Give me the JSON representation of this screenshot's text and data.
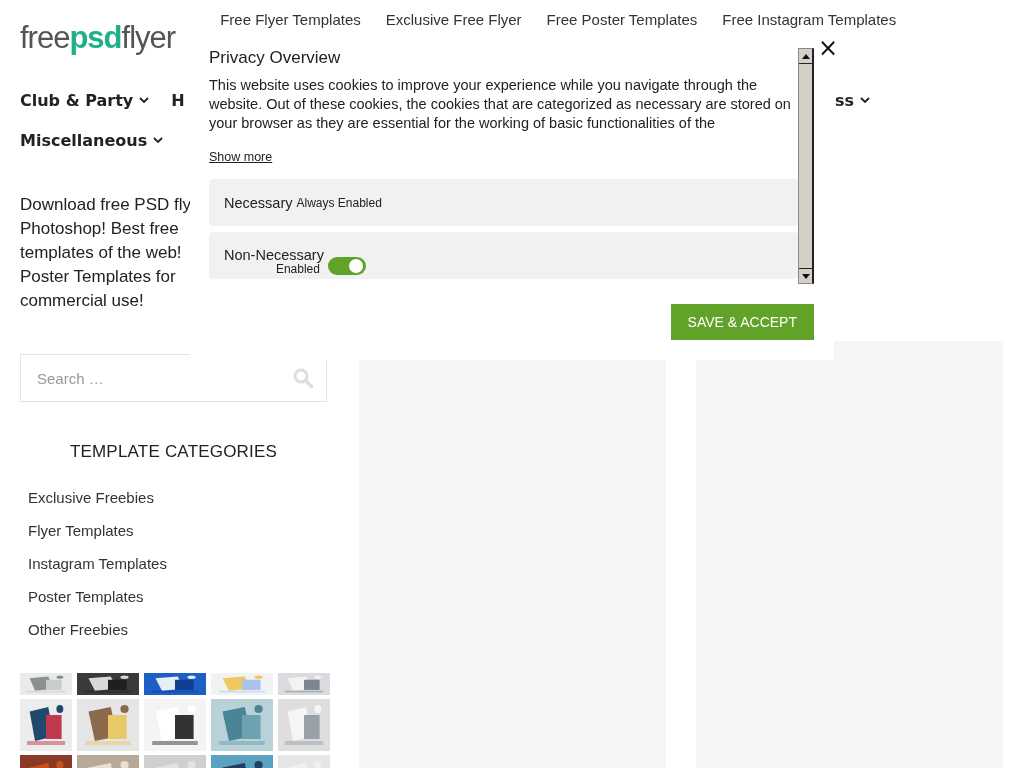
{
  "logo": "free**psd**flyer",
  "top_links": [
    "Free Flyer Templates",
    "Exclusive Free Flyer",
    "Free Poster Templates",
    "Free Instagram Templates"
  ],
  "nav": [
    {
      "label": "Club & Party",
      "chevron": true
    },
    {
      "label": "H",
      "chevron": false
    },
    {
      "label": "ss",
      "chevron": true
    }
  ],
  "nav_second": [
    {
      "label": "Miscellaneous",
      "chevron": true
    }
  ],
  "intro_lines": [
    "Download free PSD fly",
    "Photoshop! Best free",
    "templates of the web!",
    "Poster Templates for",
    "commercial use!"
  ],
  "search": {
    "placeholder": "Search …"
  },
  "categories": {
    "title": "TEMPLATE CATEGORIES",
    "items": [
      "Exclusive Freebies",
      "Flyer Templates",
      "Instagram Templates",
      "Poster Templates",
      "Other Freebies"
    ]
  },
  "thumbnails": [
    {
      "kind": "picture"
    },
    {
      "kind": "picture"
    },
    {
      "kind": "picture"
    },
    {
      "kind": "picture"
    },
    {
      "kind": "picture"
    },
    {
      "kind": "picture"
    },
    {
      "kind": "picture"
    },
    {
      "kind": "picture"
    },
    {
      "kind": "picture"
    },
    {
      "kind": "picture"
    },
    {
      "kind": "picture"
    },
    {
      "kind": "picture"
    },
    {
      "kind": "picture"
    },
    {
      "kind": "picture"
    },
    {
      "kind": "picture"
    }
  ],
  "privacy": {
    "title": "Privacy Overview",
    "text": "This website uses cookies to improve your experience while you navigate through the website. Out of these cookies, the cookies that are categorized as necessary are stored on your browser as they are essential for the working of basic functionalities of the",
    "show_more": "Show more",
    "groups": [
      {
        "kind": "always",
        "name": "Necessary",
        "status": "Always Enabled"
      },
      {
        "kind": "toggle",
        "name": "Non-Necessary",
        "status": "Enabled",
        "on": true
      }
    ],
    "button": "SAVE & ACCEPT",
    "close": "×"
  }
}
